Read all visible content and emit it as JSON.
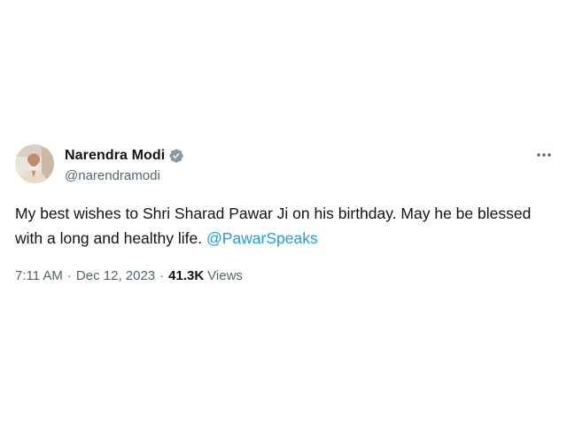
{
  "author": {
    "display_name": "Narendra Modi",
    "handle": "@narendramodi",
    "verified": true,
    "verified_color": "#829aab",
    "avatar_icon": "profile-photo"
  },
  "tweet": {
    "text": "My best wishes to Shri Sharad Pawar Ji on his birthday. May he be blessed with a long and healthy life. ",
    "mention": "@PawarSpeaks"
  },
  "meta": {
    "time": "7:11 AM",
    "separator": "·",
    "date": "Dec 12, 2023",
    "views_count": "41.3K",
    "views_label": "Views"
  },
  "more_icon": "more-horizontal-icon",
  "colors": {
    "text": "#0f1419",
    "secondary": "#536471",
    "link": "#1d9bf0"
  }
}
